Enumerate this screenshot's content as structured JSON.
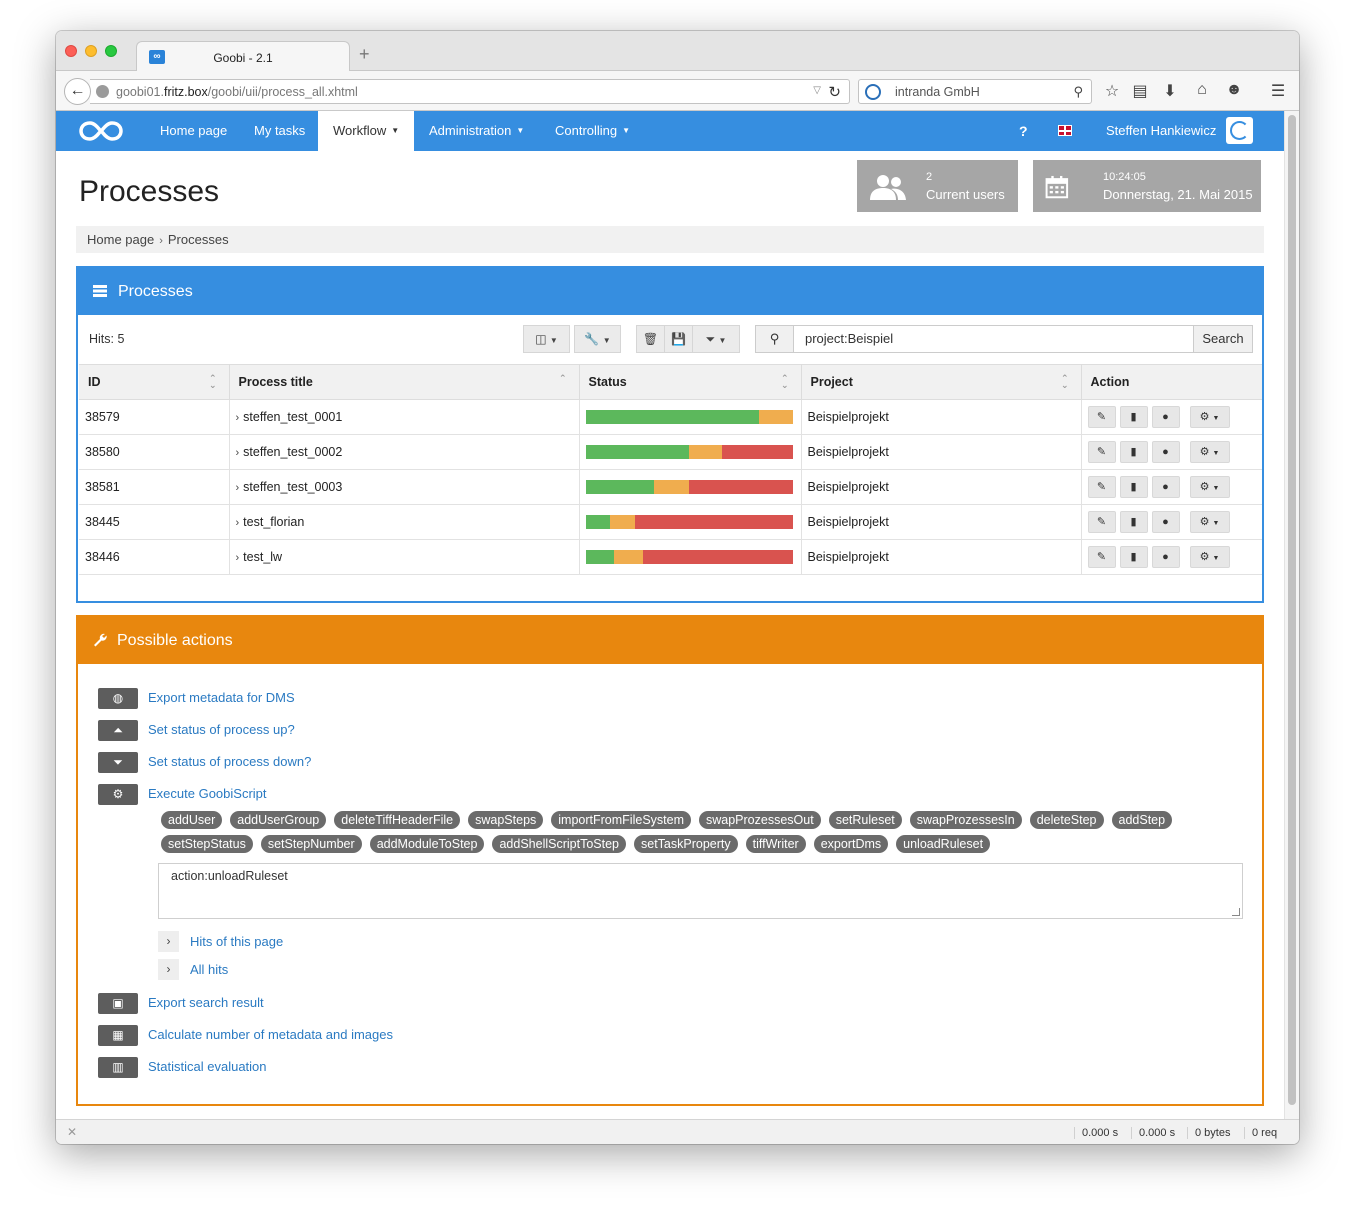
{
  "browser": {
    "tab_title": "Goobi - 2.1",
    "favicon": "∞",
    "url_prefix": "goobi01.",
    "url_host": "fritz.box",
    "url_path": "/goobi/uii/process_all.xhtml",
    "search_engine_text": "intranda GmbH"
  },
  "navbar": {
    "items": [
      {
        "label": "Home page"
      },
      {
        "label": "My tasks"
      },
      {
        "label": "Workflow"
      },
      {
        "label": "Administration"
      },
      {
        "label": "Controlling"
      }
    ],
    "help": "?",
    "user": "Steffen Hankiewicz"
  },
  "header": {
    "title": "Processes",
    "users_count": "2",
    "users_label": "Current users",
    "time": "10:24:05",
    "date": "Donnerstag, 21. Mai 2015"
  },
  "breadcrumb": [
    "Home page",
    "Processes"
  ],
  "processes": {
    "title": "Processes",
    "hits": "Hits: 5",
    "search_value": "project:Beispiel",
    "search_button": "Search",
    "columns": [
      "ID",
      "Process title",
      "Status",
      "Project",
      "Action"
    ],
    "rows": [
      {
        "id": "38579",
        "title": "steffen_test_0001",
        "project": "Beispielprojekt",
        "status": [
          84,
          16,
          0
        ]
      },
      {
        "id": "38580",
        "title": "steffen_test_0002",
        "project": "Beispielprojekt",
        "status": [
          50,
          16,
          34
        ]
      },
      {
        "id": "38581",
        "title": "steffen_test_0003",
        "project": "Beispielprojekt",
        "status": [
          33,
          17,
          50
        ]
      },
      {
        "id": "38445",
        "title": "test_florian",
        "project": "Beispielprojekt",
        "status": [
          12,
          12,
          76
        ]
      },
      {
        "id": "38446",
        "title": "test_lw",
        "project": "Beispielprojekt",
        "status": [
          14,
          14,
          72
        ]
      }
    ],
    "status_colors": {
      "done": "#5cb85c",
      "open": "#f0ad4e",
      "locked": "#d9534f"
    }
  },
  "actions": {
    "title": "Possible actions",
    "items": {
      "export_dms": "Export metadata for DMS",
      "status_up": "Set status of process up?",
      "status_down": "Set status of process down?",
      "goobiscript": "Execute GoobiScript",
      "export_search": "Export search result",
      "calc_metadata": "Calculate number of metadata and images",
      "statistics": "Statistical evaluation"
    },
    "tags": [
      "addUser",
      "addUserGroup",
      "deleteTiffHeaderFile",
      "swapSteps",
      "importFromFileSystem",
      "swapProzessesOut",
      "setRuleset",
      "swapProzessesIn",
      "deleteStep",
      "addStep",
      "setStepStatus",
      "setStepNumber",
      "addModuleToStep",
      "addShellScriptToStep",
      "setTaskProperty",
      "tiffWriter",
      "exportDms",
      "unloadRuleset"
    ],
    "script_value": "action:unloadRuleset",
    "hits_page": "Hits of this page",
    "all_hits": "All hits"
  },
  "statusbar": [
    "0.000 s",
    "0.000 s",
    "0 bytes",
    "0 req"
  ],
  "colors": {
    "primary": "#368ee0",
    "orange": "#e8870e",
    "gray_box": "#a6a6a6"
  }
}
